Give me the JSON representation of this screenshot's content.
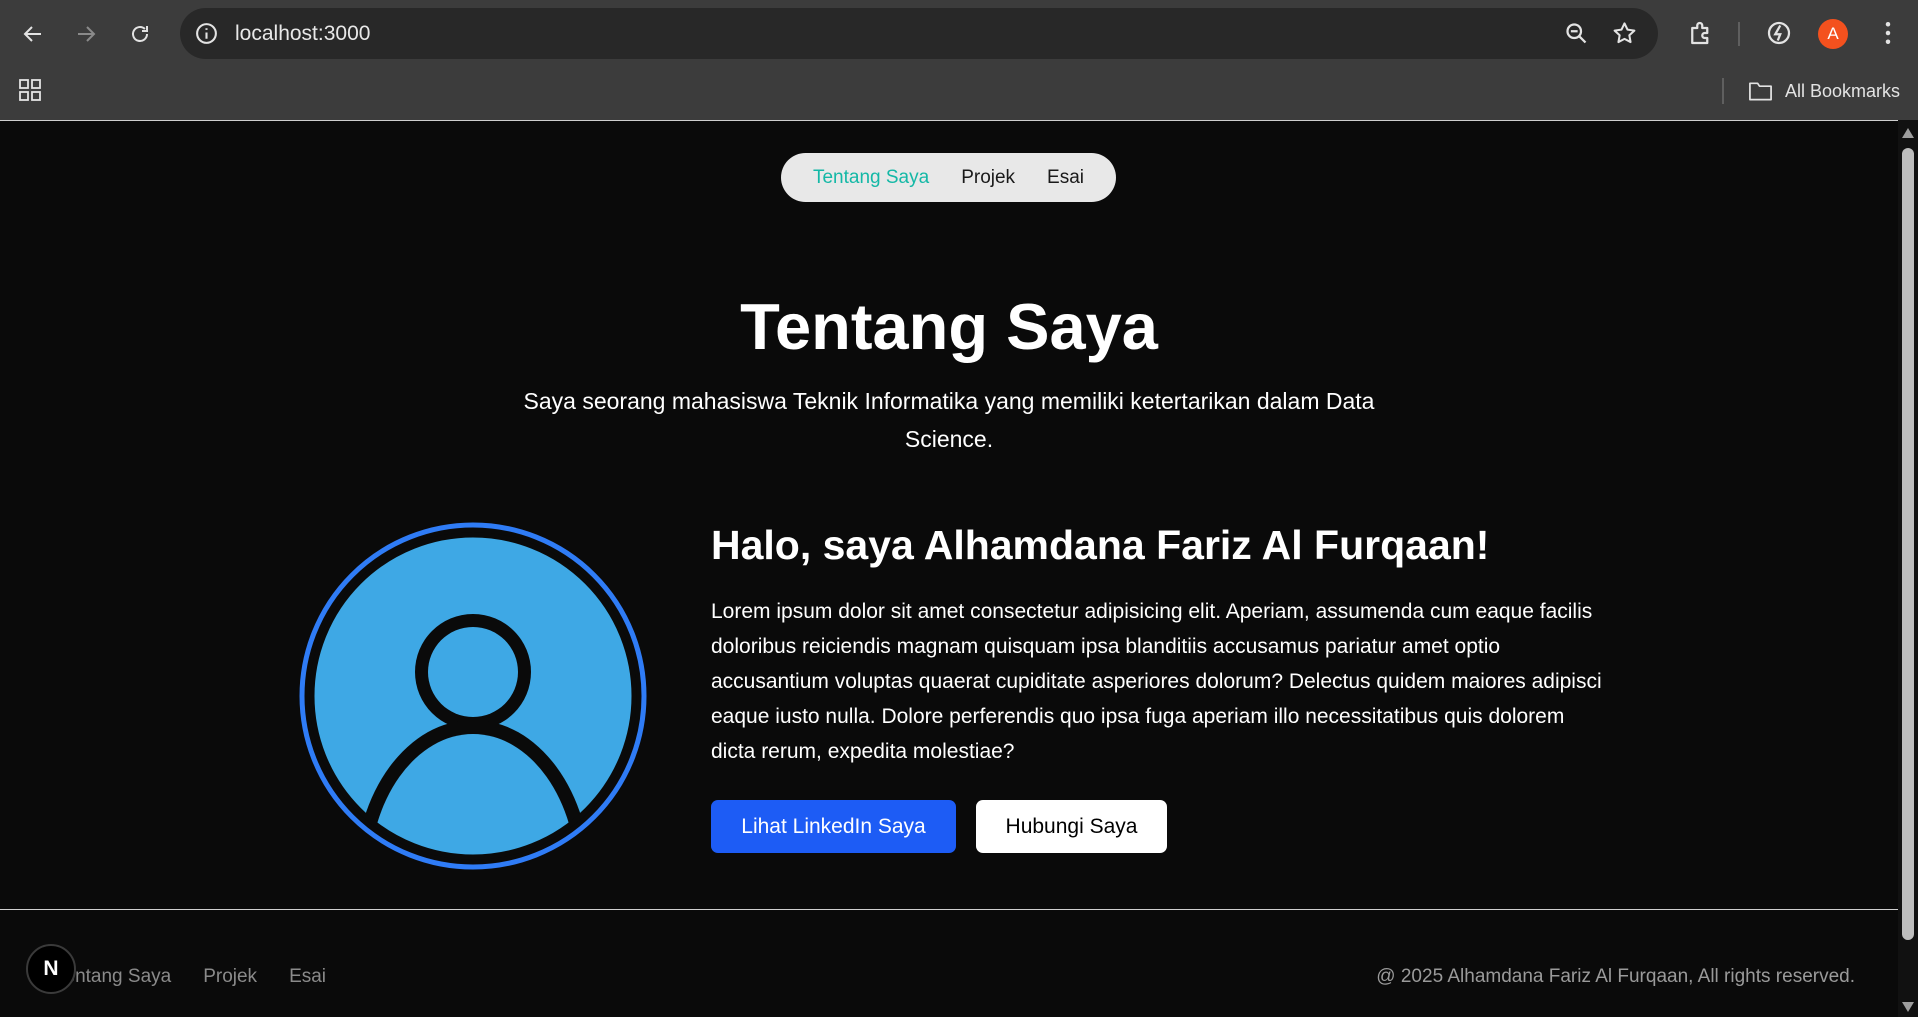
{
  "browser": {
    "url": "localhost:3000",
    "profile_initial": "A",
    "bookmarks_label": "All Bookmarks",
    "icons": [
      "back-icon",
      "forward-icon",
      "reload-icon",
      "info-icon",
      "zoom-icon",
      "star-icon",
      "extensions-icon",
      "performance-icon",
      "menu-icon",
      "apps-icon",
      "folder-icon"
    ]
  },
  "nav": {
    "items": [
      {
        "label": "Tentang Saya",
        "active": true
      },
      {
        "label": "Projek",
        "active": false
      },
      {
        "label": "Esai",
        "active": false
      }
    ],
    "active_color": "#14b8a6"
  },
  "hero": {
    "title": "Tentang Saya",
    "subtitle": "Saya seorang mahasiswa Teknik Informatika yang memiliki ketertarikan dalam Data Science."
  },
  "profile": {
    "greeting": "Halo, saya Alhamdana Fariz Al Furqaan!",
    "description": "Lorem ipsum dolor sit amet consectetur adipisicing elit. Aperiam, assumenda cum eaque facilis doloribus reiciendis magnam quisquam ipsa blanditiis accusamus pariatur amet optio accusantium voluptas quaerat cupiditate asperiores dolorum? Delectus quidem maiores adipisci eaque iusto nulla. Dolore perferendis quo ipsa fuga aperiam illo necessitatibus quis dolorem dicta rerum, expedita molestiae?",
    "linkedin_button": "Lihat LinkedIn Saya",
    "contact_button": "Hubungi Saya",
    "avatar_icon": "user-avatar-icon",
    "colors": {
      "avatar_fill": "#3ea8e5",
      "avatar_ring": "#2f7cf6",
      "primary_button": "#1d5cf5"
    }
  },
  "footer": {
    "links": [
      "Tentang Saya",
      "Projek",
      "Esai"
    ],
    "copyright": "@ 2025 Alhamdana Fariz Al Furqaan, All rights reserved.",
    "badge": "N"
  }
}
